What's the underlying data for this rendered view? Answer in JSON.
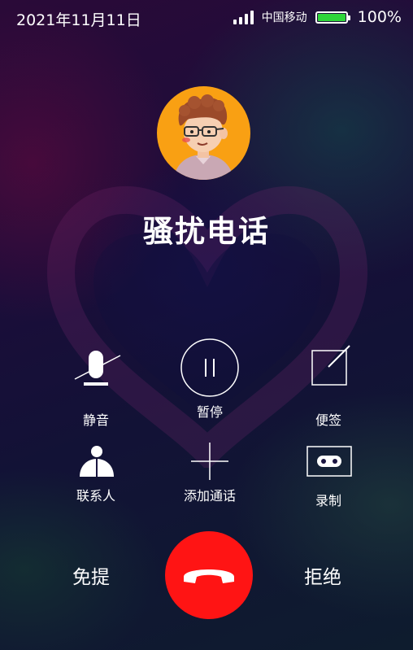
{
  "status_bar": {
    "time": "2021年11月11日",
    "carrier": "中国移动",
    "battery_percent": "100%",
    "battery_level": 1.0,
    "signal_bars": 4,
    "battery_color": "#2fd53a"
  },
  "caller": {
    "name": "骚扰电话",
    "avatar_icon": "cartoon-boy-avatar",
    "avatar_bg": "#f9a013"
  },
  "controls": {
    "mute": {
      "label": "静音",
      "icon": "mute-mic-icon"
    },
    "hold": {
      "label": "暂停",
      "icon": "pause-icon"
    },
    "note": {
      "label": "便签",
      "icon": "note-icon"
    },
    "contacts": {
      "label": "联系人",
      "icon": "contact-icon"
    },
    "add_call": {
      "label": "添加通话",
      "icon": "plus-icon"
    },
    "record": {
      "label": "录制",
      "icon": "record-icon"
    }
  },
  "bottom": {
    "speaker_label": "免提",
    "reject_label": "拒绝",
    "hangup_icon": "hang-up-phone-icon",
    "hangup_color": "#ff1414"
  }
}
